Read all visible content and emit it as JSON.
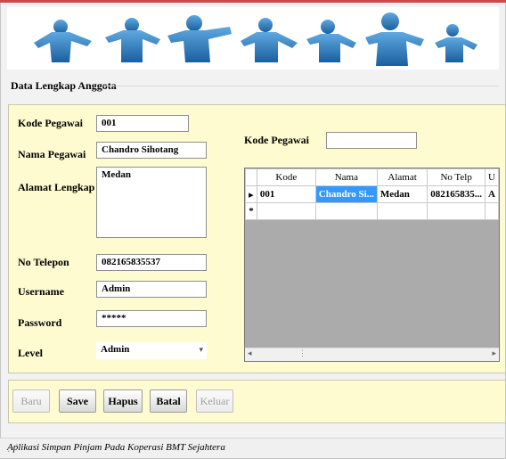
{
  "form": {
    "section_title": "Data Lengkap Anggota",
    "labels": {
      "kode_pegawai": "Kode Pegawai",
      "nama_pegawai": "Nama Pegawai",
      "alamat_lengkap": "Alamat Lengkap",
      "no_telepon": "No Telepon",
      "username": "Username",
      "password": "Password",
      "level": "Level",
      "search_kode": "Kode Pegawai"
    },
    "values": {
      "kode_pegawai": "001",
      "nama_pegawai": "Chandro Sihotang",
      "alamat_lengkap": "Medan",
      "no_telepon": "082165835537",
      "username": "Admin",
      "password": "*****",
      "level": "Admin",
      "search_kode": ""
    }
  },
  "grid": {
    "columns": [
      "Kode",
      "Nama",
      "Alamat",
      "No Telp",
      "U"
    ],
    "rows": [
      {
        "indicator": "▸",
        "cells": [
          "001",
          "Chandro Si...",
          "Medan",
          "082165835...",
          "A"
        ]
      }
    ],
    "new_row_indicator": "*"
  },
  "buttons": {
    "baru": "Baru",
    "save": "Save",
    "hapus": "Hapus",
    "batal": "Batal",
    "keluar": "Keluar"
  },
  "status": {
    "text": "Aplikasi Simpan Pinjam Pada Koperasi  BMT Sejahtera"
  },
  "colors": {
    "panel_bg": "#fffbd0",
    "selection": "#3399ff",
    "banner_figures": "#1a6fb0"
  }
}
